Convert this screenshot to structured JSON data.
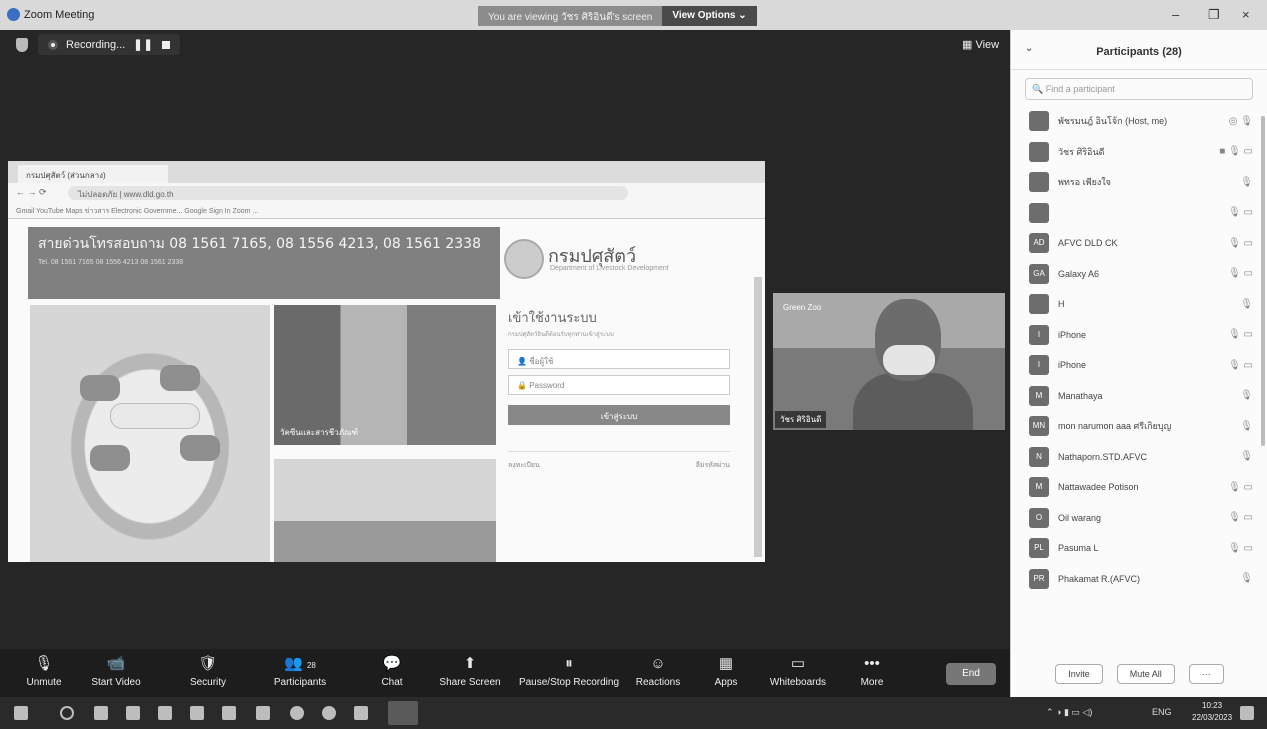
{
  "window": {
    "title": "Zoom Meeting",
    "viewing_msg": "You are viewing วัชร ศิริอินดี's screen",
    "view_options": "View Options",
    "view_options_chevron": "⌄",
    "min": "–",
    "restore": "❐",
    "close": "×"
  },
  "meeting": {
    "recording_label": "Recording...",
    "view_label": "View"
  },
  "shared_screen": {
    "tab_title": "กรมปศุสัตว์ (ส่วนกลาง)",
    "url": "ไม่ปลอดภัย | www.dld.go.th",
    "bookmarks": "Gmail   YouTube   Maps   ข่าวสาร   Electronic Governme...   Google   Sign In   Zoom   ...",
    "hotline": "สายด่วนโทรสอบถาม 08 1561 7165, 08 1556 4213, 08 1561 2338",
    "hotline_small": "Tel. 08 1561 7165  08 1556 4213  08 1561 2338",
    "dept_name": "กรมปศุสัตว์",
    "dept_sub": "Department of Livestock Development",
    "login_title": "เข้าใช้งานระบบ",
    "login_desc": "กรมปศุสัตว์ยินดีต้อนรับทุกท่านเข้าสู่ระบบ",
    "username_placeholder": "ชื่อผู้ใช้",
    "password_placeholder": "Password",
    "login_button": "เข้าสู่ระบบ",
    "link_register": "ลงทะเบียน",
    "link_forgot": "ลืมรหัสผ่าน",
    "photo_caption": "วัคซีนและสารชีวภัณฑ์"
  },
  "video": {
    "banner": "Green Zoo",
    "name": "วัชร ศิริอินดี"
  },
  "toolbar": {
    "items": [
      {
        "label": "Unmute",
        "icon": "🎙"
      },
      {
        "label": "Start Video",
        "icon": "📹"
      },
      {
        "label": "Security",
        "icon": "🛡"
      },
      {
        "label": "Participants",
        "icon": "👥",
        "badge": "28"
      },
      {
        "label": "Chat",
        "icon": "💬"
      },
      {
        "label": "Share Screen",
        "icon": "⬆"
      },
      {
        "label": "Pause/Stop Recording",
        "icon": "⏸"
      },
      {
        "label": "Reactions",
        "icon": "☺"
      },
      {
        "label": "Apps",
        "icon": "▦"
      },
      {
        "label": "Whiteboards",
        "icon": "▭"
      },
      {
        "label": "More",
        "icon": "•••"
      }
    ],
    "end_label": "End"
  },
  "participants": {
    "title": "Participants (28)",
    "search_placeholder": "Find a participant",
    "list": [
      {
        "name": "พัชรมนฎ์ อินโจ้ก (Host, me)",
        "avatar": "",
        "icons": "◎ 🎙"
      },
      {
        "name": "วัชร ศิริอินดี",
        "avatar": "",
        "icons": "■ 🎙 ▭"
      },
      {
        "name": "พทรอ เพียงใจ",
        "avatar": "",
        "icons": "🎙"
      },
      {
        "name": "",
        "avatar": "",
        "icons": "🎙 ▭"
      },
      {
        "name": "AFVC DLD CK",
        "avatar": "AD",
        "icons": "🎙 ▭"
      },
      {
        "name": "Galaxy A6",
        "avatar": "GA",
        "icons": "🎙 ▭"
      },
      {
        "name": "H",
        "avatar": "",
        "icons": "🎙"
      },
      {
        "name": "iPhone",
        "avatar": "I",
        "icons": "🎙 ▭"
      },
      {
        "name": "iPhone",
        "avatar": "I",
        "icons": "🎙 ▭"
      },
      {
        "name": "Manathaya",
        "avatar": "M",
        "icons": "🎙"
      },
      {
        "name": "mon narumon aaa ศรีเกิยบุญ",
        "avatar": "MN",
        "icons": "🎙"
      },
      {
        "name": "Nathaporn.STD.AFVC",
        "avatar": "N",
        "icons": "🎙"
      },
      {
        "name": "Nattawadee Potison",
        "avatar": "M",
        "icons": "🎙 ▭"
      },
      {
        "name": "Oil warang",
        "avatar": "O",
        "icons": "🎙 ▭"
      },
      {
        "name": "Pasuma L",
        "avatar": "PL",
        "icons": "🎙 ▭"
      },
      {
        "name": "Phakamat R.(AFVC)",
        "avatar": "PR",
        "icons": "🎙"
      }
    ],
    "invite": "Invite",
    "mute_all": "Mute All",
    "more": "···"
  },
  "taskbar": {
    "lang": "ENG",
    "time": "10:23",
    "date": "22/03/2023"
  }
}
